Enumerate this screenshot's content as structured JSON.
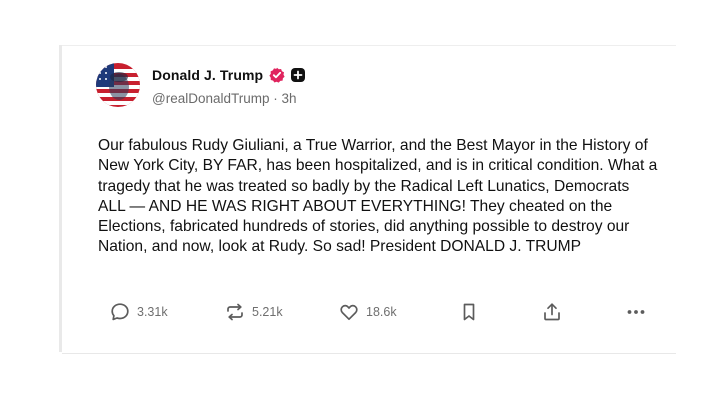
{
  "post": {
    "author_name": "Donald J. Trump",
    "handle": "@realDonaldTrump",
    "separator": "·",
    "time_ago": "3h",
    "body": "Our fabulous Rudy Giuliani, a True Warrior, and the Best Mayor in the History of New York City, BY FAR, has been hospitalized, and is in critical condition. What a tragedy that he was treated so badly by the Radical Left Lunatics, Democrats ALL — AND HE WAS RIGHT ABOUT EVERYTHING! They cheated on the Elections, fabricated hundreds of stories, did anything possible to destroy our Nation, and now, look at Rudy. So sad! President DONALD J. TRUMP"
  },
  "actions": {
    "replies": "3.31k",
    "reposts": "5.21k",
    "likes": "18.6k"
  },
  "icons": {
    "verified": "verified-badge-icon",
    "plus": "plus-badge-icon",
    "reply": "comment-icon",
    "repost": "repost-icon",
    "like": "heart-icon",
    "bookmark": "bookmark-icon",
    "share": "share-icon",
    "more": "more-icon"
  },
  "colors": {
    "verified": "#e0245e",
    "text": "#111111",
    "muted": "#6b6b6b"
  }
}
